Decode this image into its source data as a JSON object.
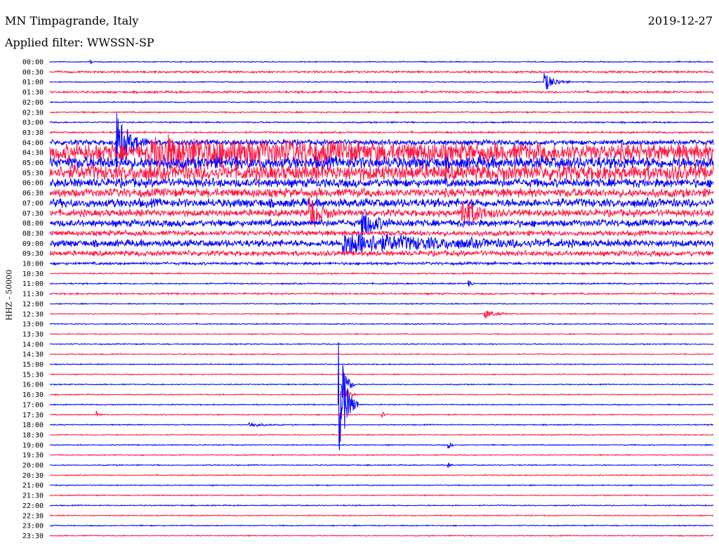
{
  "header": {
    "station": "MN Timpagrande, Italy",
    "date": "2019-12-27",
    "filter_label": "Applied filter: WWSSN-SP"
  },
  "chart_data": {
    "type": "helicorder",
    "title": "MN Timpagrande, Italy",
    "date": "2019-12-27",
    "filter": "WWSSN-SP",
    "ylabel": "HHZ - 50000",
    "row_minutes": 30,
    "row_labels": [
      "00:00",
      "00:30",
      "01:00",
      "01:30",
      "02:00",
      "02:30",
      "03:00",
      "03:30",
      "04:00",
      "04:30",
      "05:00",
      "05:30",
      "06:00",
      "06:30",
      "07:00",
      "07:30",
      "08:00",
      "08:30",
      "09:00",
      "09:30",
      "10:00",
      "10:30",
      "11:00",
      "11:30",
      "12:00",
      "12:30",
      "13:00",
      "13:30",
      "14:00",
      "14:30",
      "15:00",
      "15:30",
      "16:00",
      "16:30",
      "17:00",
      "17:30",
      "18:00",
      "18:30",
      "19:00",
      "19:30",
      "20:00",
      "20:30",
      "21:00",
      "21:30",
      "22:00",
      "22:30",
      "23:00",
      "23:30"
    ],
    "trace_colors": [
      "#0000ff",
      "#ff1744"
    ],
    "background_noise": [
      0.6,
      1.2,
      0.6,
      1.2,
      0.6,
      0.8,
      0.8,
      1,
      3,
      10,
      7,
      9,
      5,
      5,
      5,
      4,
      4,
      3,
      4,
      3,
      1.5,
      0.8,
      0.8,
      1,
      0.6,
      0.6,
      0.6,
      0.6,
      0.6,
      0.6,
      0.6,
      0.6,
      0.6,
      0.6,
      0.6,
      0.6,
      0.6,
      0.6,
      0.6,
      0.6,
      0.6,
      0.6,
      0.6,
      0.6,
      0.6,
      0.6,
      0.6,
      0.6
    ],
    "events": [
      {
        "row": 0,
        "pos": 0.06,
        "amp": 8,
        "dur": 0.004
      },
      {
        "row": 2,
        "pos": 0.745,
        "amp": 14,
        "dur": 0.04
      },
      {
        "row": 8,
        "pos": 0.1,
        "amp": 45,
        "dur": 0.05
      },
      {
        "row": 9,
        "pos": 0.15,
        "amp": 16,
        "dur": 0.6
      },
      {
        "row": 15,
        "pos": 0.39,
        "amp": 30,
        "dur": 0.04
      },
      {
        "row": 15,
        "pos": 0.62,
        "amp": 25,
        "dur": 0.06
      },
      {
        "row": 16,
        "pos": 0.47,
        "amp": 22,
        "dur": 0.05
      },
      {
        "row": 18,
        "pos": 0.44,
        "amp": 14,
        "dur": 0.35
      },
      {
        "row": 22,
        "pos": 0.63,
        "amp": 10,
        "dur": 0.01
      },
      {
        "row": 25,
        "pos": 0.655,
        "amp": 7,
        "dur": 0.04
      },
      {
        "row": 32,
        "pos": 0.44,
        "amp": 40,
        "dur": 0.02
      },
      {
        "row": 33,
        "pos": 0.445,
        "amp": 10,
        "dur": 0.02
      },
      {
        "row": 34,
        "pos": 0.435,
        "amp": 90,
        "dur": 0.03
      },
      {
        "row": 35,
        "pos": 0.07,
        "amp": 8,
        "dur": 0.01
      },
      {
        "row": 35,
        "pos": 0.5,
        "amp": 6,
        "dur": 0.01
      },
      {
        "row": 36,
        "pos": 0.3,
        "amp": 4,
        "dur": 0.05
      },
      {
        "row": 38,
        "pos": 0.6,
        "amp": 6,
        "dur": 0.01
      },
      {
        "row": 40,
        "pos": 0.6,
        "amp": 5,
        "dur": 0.01
      }
    ]
  }
}
